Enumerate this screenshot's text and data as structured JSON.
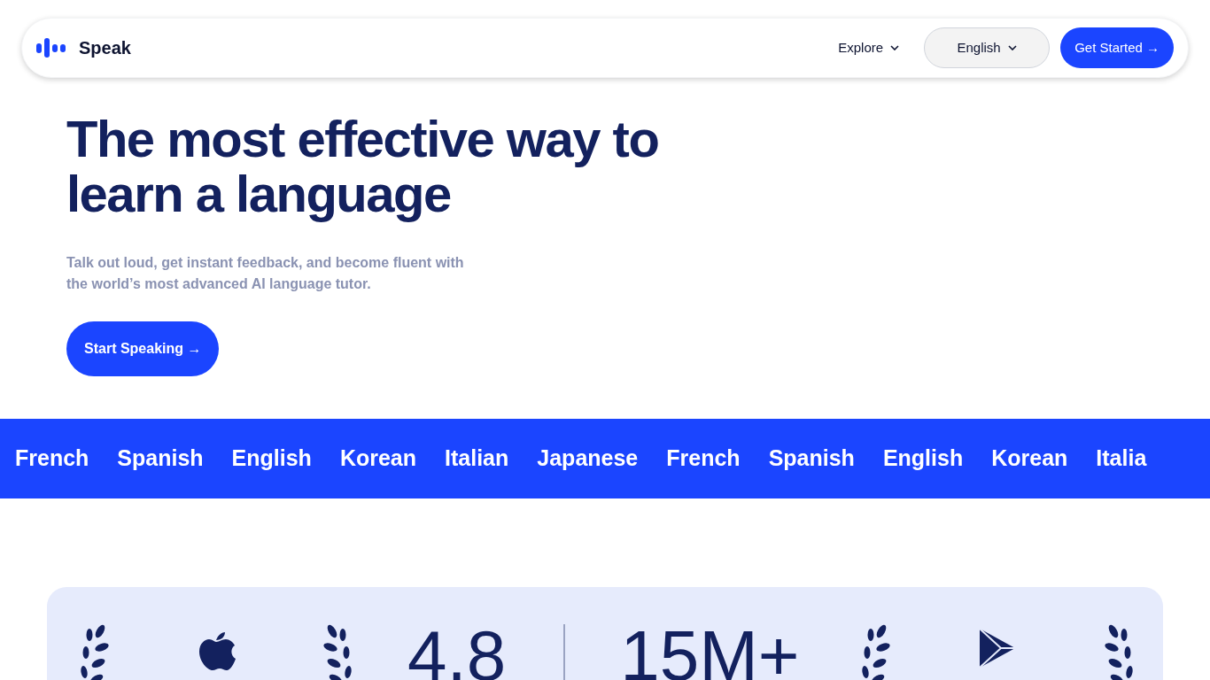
{
  "nav": {
    "brand": "Speak",
    "explore": {
      "label": "Explore"
    },
    "language": {
      "label": "English"
    },
    "cta": {
      "label": "Get Started →"
    }
  },
  "hero": {
    "title": "The most effective way to learn a language",
    "subtitle": "Talk out loud, get instant feedback, and become fluent with the world’s most advanced AI language tutor.",
    "button": "Start Speaking →"
  },
  "ticker": [
    "French",
    "Spanish",
    "English",
    "Korean",
    "Italian",
    "Japanese",
    "French",
    "Spanish",
    "English",
    "Korean",
    "Italia"
  ],
  "stats": [
    {
      "kind": "apple",
      "value": "4.8"
    },
    {
      "kind": "play",
      "value": "15M+"
    }
  ]
}
